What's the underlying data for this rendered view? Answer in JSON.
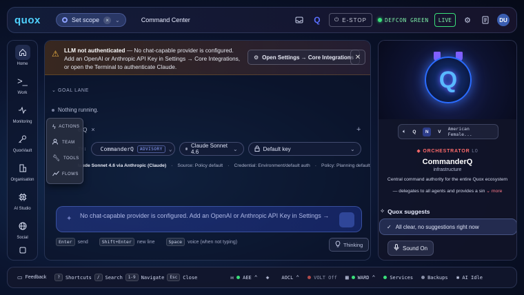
{
  "topbar": {
    "logo": "quox",
    "scope_label": "Set scope",
    "title": "Command Center",
    "estop": "E-STOP",
    "defcon": "DEFCON GREEN",
    "live": "LIVE",
    "avatar": "DU"
  },
  "sidebar": {
    "items": [
      {
        "label": "Home",
        "icon": "home-icon"
      },
      {
        "label": "Work",
        "icon": "terminal-icon"
      },
      {
        "label": "Monitoring",
        "icon": "activity-icon"
      },
      {
        "label": "QuoxVault",
        "icon": "key-icon"
      },
      {
        "label": "Organisation",
        "icon": "building-icon"
      },
      {
        "label": "AI Studio",
        "icon": "chip-icon"
      },
      {
        "label": "Social",
        "icon": "globe-icon"
      }
    ]
  },
  "banner": {
    "title": "LLM not authenticated",
    "message": "— No chat-capable provider is configured. Add an OpenAI or Anthropic API Key in Settings → Core Integrations, or open the Terminal to authenticate Claude.",
    "button": "Open Settings → Core Integrations"
  },
  "goal_lane": {
    "title": "GOAL LANE",
    "empty": "Nothing running."
  },
  "context_menu": {
    "items": [
      "ACTIONS",
      "TEAM",
      "TOOLS",
      "FLOWS"
    ]
  },
  "tab": {
    "label": "erQ"
  },
  "with_row": {
    "label": "TH:",
    "agent": "CommanderQ",
    "badge": "ADVISORY",
    "model": "Claude Sonnet 4.6",
    "key": "Default key"
  },
  "info": {
    "route": "laude Sonnet 4.6 via Anthropic (Claude)",
    "source": "Source: Policy default",
    "credential": "Credential: Environment/default auth",
    "policy": "Policy: Planning default"
  },
  "chat": {
    "placeholder": "No chat-capable provider is configured. Add an OpenAI or Anthropic API Key in Settings →"
  },
  "hints": {
    "enter": "Enter",
    "send": "send",
    "shift_enter": "Shift+Enter",
    "newline": "new line",
    "space": "Space",
    "voice": "voice (when not typing)",
    "thinking": "Thinking"
  },
  "right": {
    "voice_chips": [
      "Q",
      "N",
      "V"
    ],
    "voice_selected": "N",
    "voice_name": "American Female...",
    "role": "ORCHESTRATOR",
    "level": "L0",
    "name": "CommanderQ",
    "category": "infrastructure",
    "desc1": "Central command authority for the entire Quox ecosystem",
    "desc2": "— delegates to all agents and provides a sin",
    "more": "more",
    "suggests_title": "Quox suggests",
    "suggestion": "All clear, no suggestions right now",
    "sound": "Sound On"
  },
  "bottombar": {
    "feedback": "Feedback",
    "shortcuts_key": "?",
    "shortcuts": "Shortcuts",
    "search_key": "/",
    "search": "Search",
    "navigate_key": "1-9",
    "navigate": "Navigate",
    "close_key": "Esc",
    "close": "Close",
    "aee": "AEE",
    "aocl": "AOCL",
    "volt": "VOLT Off",
    "ward": "WARD",
    "services": "Services",
    "backups": "Backups",
    "ai_idle": "AI Idle"
  }
}
